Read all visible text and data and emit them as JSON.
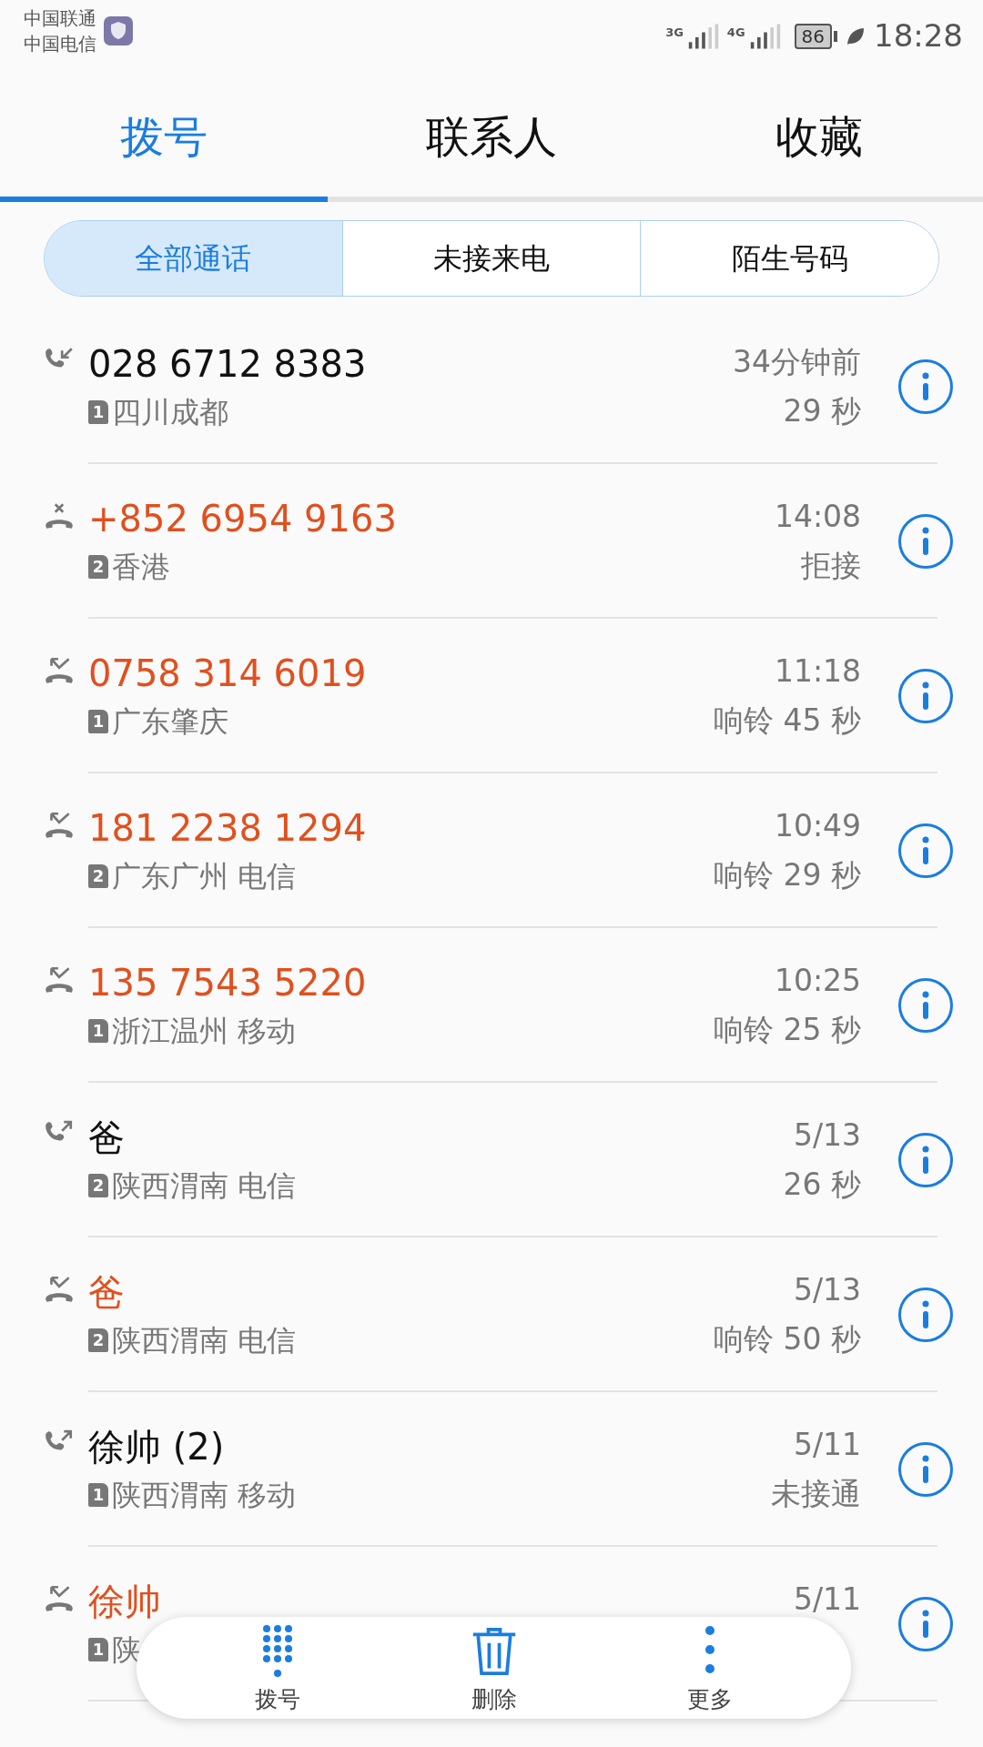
{
  "status_bar": {
    "carriers": [
      "中国联通",
      "中国电信"
    ],
    "network_1": "3G",
    "network_2": "4G",
    "battery": "86",
    "time": "18:28"
  },
  "tabs": [
    {
      "label": "拨号",
      "selected": true
    },
    {
      "label": "联系人",
      "selected": false
    },
    {
      "label": "收藏",
      "selected": false
    }
  ],
  "filters": [
    {
      "label": "全部通话",
      "selected": true
    },
    {
      "label": "未接来电",
      "selected": false
    },
    {
      "label": "陌生号码",
      "selected": false
    }
  ],
  "calls": [
    {
      "kind": "incoming",
      "name": "028 6712 8383",
      "sim": "1",
      "location": "四川成都",
      "time": "34分钟前",
      "detail": "29 秒"
    },
    {
      "kind": "rejected",
      "name": "+852 6954 9163",
      "sim": "2",
      "location": "香港",
      "time": "14:08",
      "detail": "拒接"
    },
    {
      "kind": "missed",
      "name": "0758 314 6019",
      "sim": "1",
      "location": "广东肇庆",
      "time": "11:18",
      "detail": "响铃 45 秒"
    },
    {
      "kind": "missed",
      "name": "181 2238 1294",
      "sim": "2",
      "location": "广东广州 电信",
      "time": "10:49",
      "detail": "响铃 29 秒"
    },
    {
      "kind": "missed",
      "name": "135 7543 5220",
      "sim": "1",
      "location": "浙江温州 移动",
      "time": "10:25",
      "detail": "响铃 25 秒"
    },
    {
      "kind": "outgoing",
      "name": "爸",
      "sim": "2",
      "location": "陕西渭南 电信",
      "time": "5/13",
      "detail": "26 秒"
    },
    {
      "kind": "missed",
      "name": "爸",
      "sim": "2",
      "location": "陕西渭南 电信",
      "time": "5/13",
      "detail": "响铃 50 秒"
    },
    {
      "kind": "outgoing",
      "name": "徐帅 (2)",
      "sim": "1",
      "location": "陕西渭南 移动",
      "time": "5/11",
      "detail": "未接通"
    },
    {
      "kind": "missed",
      "name": "徐帅",
      "sim": "1",
      "location": "陕",
      "time": "5/11"
    }
  ],
  "bottom_bar": [
    {
      "kind": "dialpad",
      "label": "拨号"
    },
    {
      "kind": "delete",
      "label": "删除"
    },
    {
      "kind": "more",
      "label": "更多"
    }
  ]
}
